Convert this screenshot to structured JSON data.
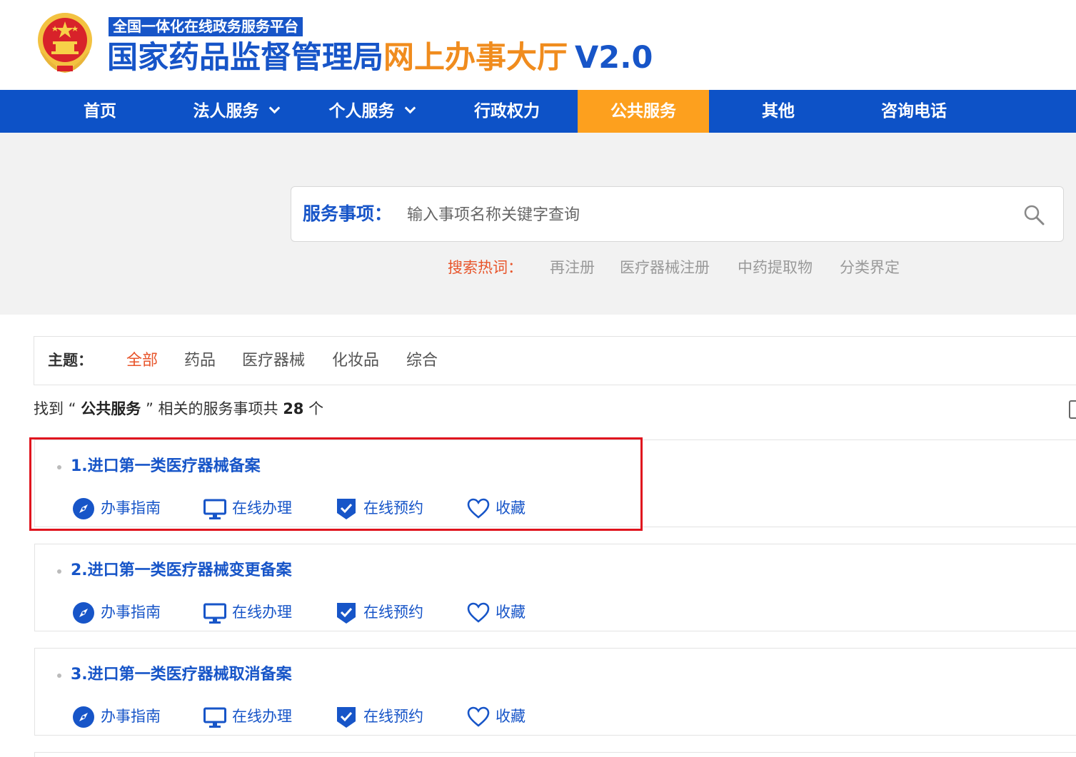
{
  "header": {
    "platform_tag": "全国一体化在线政务服务平台",
    "title_main": "国家药品监督管理局",
    "title_sub": "网上办事大厅",
    "title_version": "V2.0",
    "emblem_icon": "national-emblem-icon"
  },
  "nav": {
    "items": [
      {
        "label": "首页"
      },
      {
        "label": "法人服务"
      },
      {
        "label": "个人服务"
      },
      {
        "label": "行政权力"
      },
      {
        "label": "公共服务"
      },
      {
        "label": "其他"
      },
      {
        "label": "咨询电话"
      }
    ],
    "active": "公共服务"
  },
  "search": {
    "label": "服务事项：",
    "placeholder": "输入事项名称关键字查询",
    "value": "",
    "hot_label": "搜索热词：",
    "hot_words": [
      "再注册",
      "医疗器械注册",
      "中药提取物",
      "分类界定"
    ]
  },
  "topics": {
    "label": "主题：",
    "items": [
      "全部",
      "药品",
      "医疗器械",
      "化妆品",
      "综合"
    ],
    "active": "全部"
  },
  "result": {
    "prefix": "找到 “",
    "keyword": "公共服务",
    "middle": "” 相关的服务事项共",
    "count": "28",
    "suffix": "个"
  },
  "services": [
    {
      "title": "1.进口第一类医疗器械备案"
    },
    {
      "title": "2.进口第一类医疗器械变更备案"
    },
    {
      "title": "3.进口第一类医疗器械取消备案"
    }
  ],
  "actions": {
    "guide": "办事指南",
    "online": "在线办理",
    "appointment": "在线预约",
    "favorite": "收藏"
  },
  "colors": {
    "brand_blue": "#0d52c7",
    "accent_orange": "#fda01e",
    "hot_red": "#e8552b",
    "highlight_red": "#e0141e"
  }
}
